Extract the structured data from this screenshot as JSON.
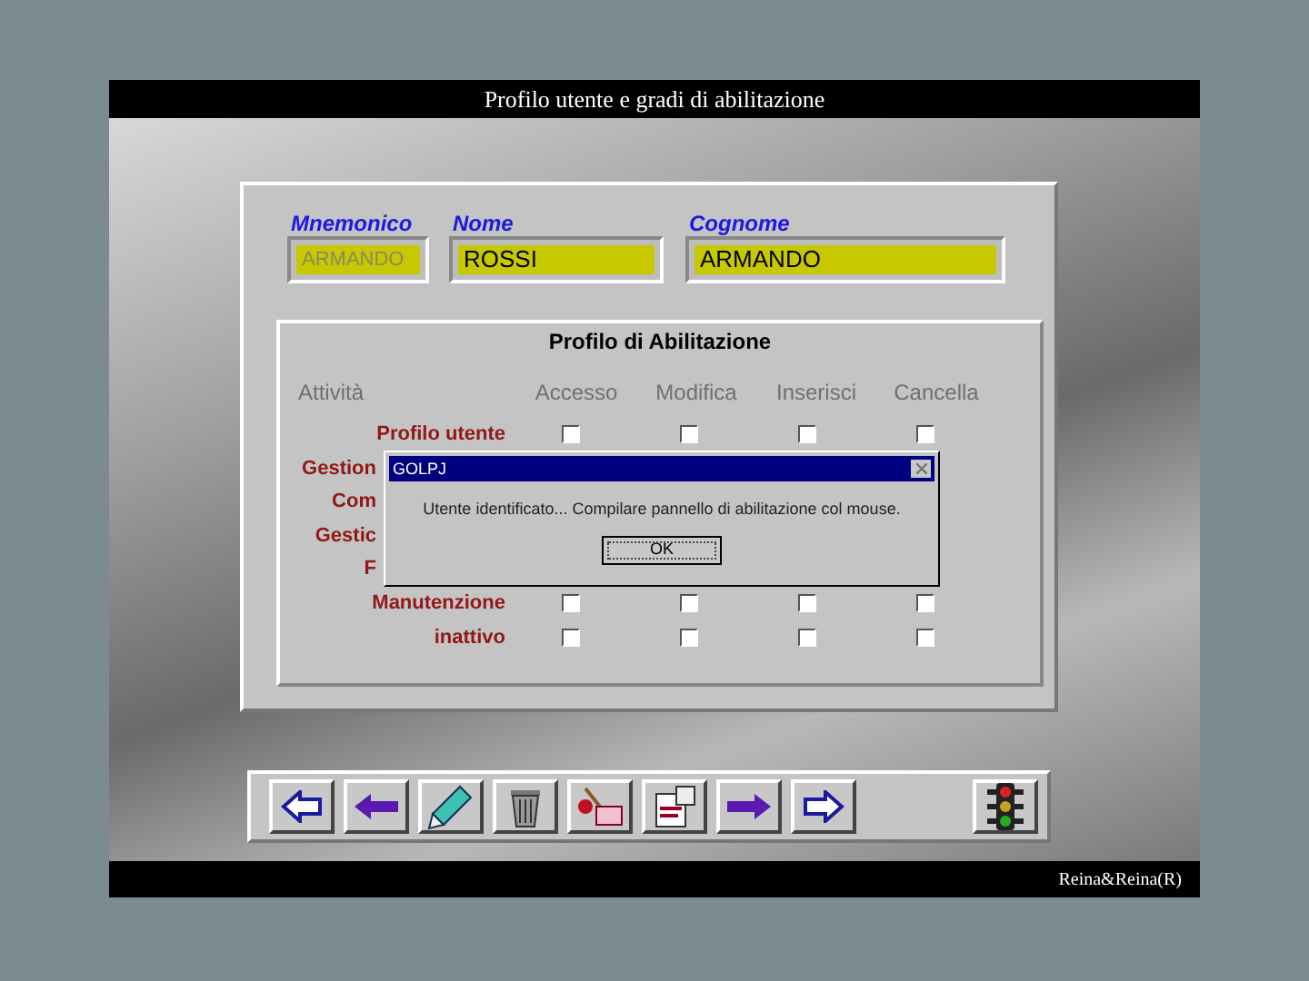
{
  "window": {
    "title": "Profilo utente e gradi di abilitazione"
  },
  "fields": [
    {
      "label": "Mnemonico",
      "value": "ARMANDO",
      "disabled": true
    },
    {
      "label": "Nome",
      "value": "ROSSI",
      "disabled": false
    },
    {
      "label": "Cognome",
      "value": "ARMANDO",
      "disabled": false
    }
  ],
  "profile_panel": {
    "title": "Profilo di Abilitazione",
    "columns": [
      "Attività",
      "Accesso",
      "Modifica",
      "Inserisci",
      "Cancella"
    ],
    "rows": [
      {
        "kind": "full",
        "label": "Profilo utente",
        "checks": [
          {
            "checked": false
          },
          {
            "checked": false
          },
          {
            "checked": false
          },
          {
            "checked": false
          }
        ]
      },
      {
        "kind": "partial",
        "label": "Gestion"
      },
      {
        "kind": "partial",
        "label": "Com"
      },
      {
        "kind": "partial",
        "label": "Gestic"
      },
      {
        "kind": "partial",
        "label": "F"
      },
      {
        "kind": "full",
        "label": "Manutenzione",
        "checks": [
          {
            "checked": false
          },
          {
            "checked": false
          },
          {
            "checked": false
          },
          {
            "checked": false
          }
        ]
      },
      {
        "kind": "full",
        "label": "inattivo",
        "checks": [
          {
            "checked": false
          },
          {
            "checked": false
          },
          {
            "checked": false
          },
          {
            "checked": false
          }
        ]
      }
    ]
  },
  "dialog": {
    "title": "GOLPJ",
    "message": "Utente identificato... Compilare pannello di abilitazione col mouse.",
    "button": "OK"
  },
  "toolbar": [
    {
      "kind": "arrow-left-outline"
    },
    {
      "kind": "arrow-left"
    },
    {
      "kind": "pencil"
    },
    {
      "kind": "trash"
    },
    {
      "kind": "paint"
    },
    {
      "kind": "document"
    },
    {
      "kind": "arrow-right"
    },
    {
      "kind": "arrow-right-outline"
    },
    {
      "kind": "gap"
    },
    {
      "kind": "traffic-light"
    }
  ],
  "footer": {
    "credit": "Reina&Reina(R)"
  }
}
